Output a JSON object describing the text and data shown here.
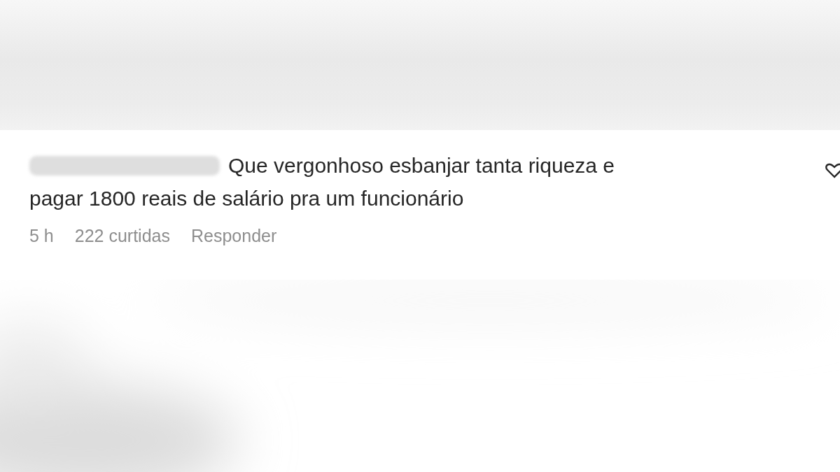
{
  "comment": {
    "text_lines": [
      "Que vergonhoso esbanjar tanta riqueza e",
      "pagar 1800 reais de salário pra um funcionário"
    ],
    "time": "5 h",
    "likes": "222 curtidas",
    "reply": "Responder",
    "liked": false
  }
}
